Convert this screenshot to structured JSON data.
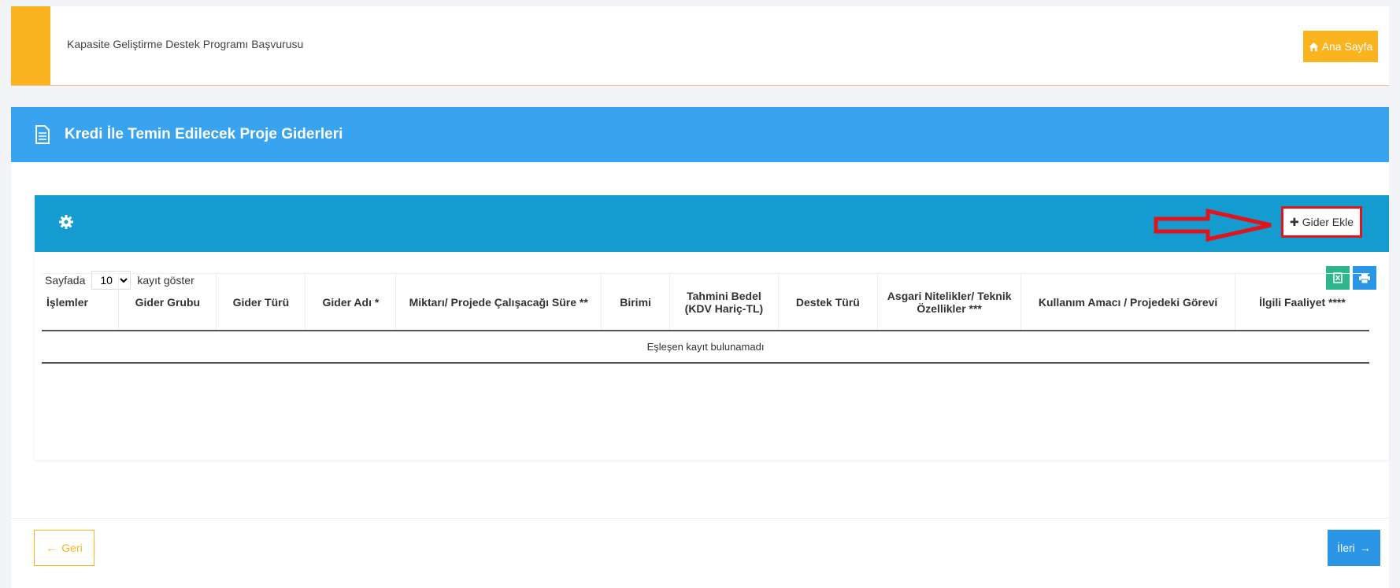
{
  "header": {
    "title": "Kapasite Geliştirme Destek Programı Başvurusu",
    "home_label": "Ana Sayfa"
  },
  "section": {
    "title": "Kredi İle Temin Edilecek Proje Giderleri"
  },
  "panel": {
    "add_label": "Gider Ekle",
    "show_prefix": "Sayfada",
    "show_value": "10",
    "show_suffix": "kayıt göster",
    "columns": [
      "İşlemler",
      "Gider Grubu",
      "Gider Türü",
      "Gider Adı *",
      "Miktarı/ Projede Çalışacağı Süre **",
      "Birimi",
      "Tahmini Bedel (KDV Hariç-TL)",
      "Destek Türü",
      "Asgari Nitelikler/ Teknik Özellikler ***",
      "Kullanım Amacı / Projedeki Görevi",
      "İlgili Faaliyet ****"
    ],
    "empty_message": "Eşleşen kayıt bulunamadı"
  },
  "footer": {
    "back_label": "Geri",
    "next_label": "İleri"
  },
  "colors": {
    "accent": "#fbb320",
    "section": "#38a3ef",
    "panel": "#149bd0",
    "highlight": "#e0141b"
  }
}
